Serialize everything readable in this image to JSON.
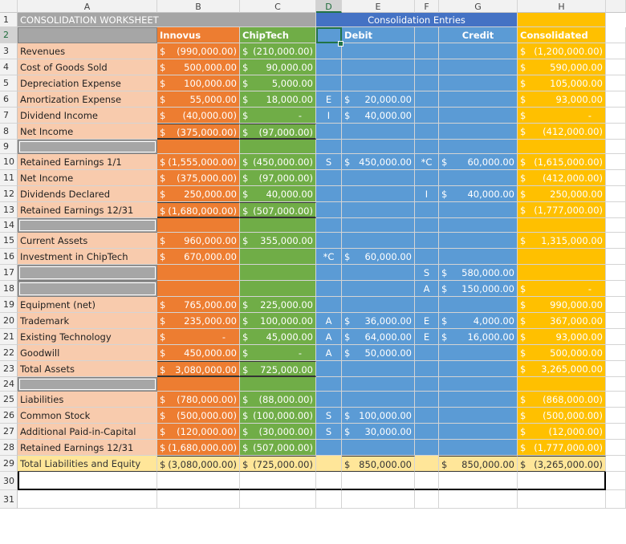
{
  "columns": [
    "A",
    "B",
    "C",
    "D",
    "E",
    "F",
    "G",
    "H"
  ],
  "rows": [
    {
      "n": "1",
      "a": "CONSOLIDATION WORKSHEET",
      "b": "",
      "c": "",
      "d": "",
      "e": "Consolidation Entries",
      "f": "",
      "g": "",
      "h": ""
    },
    {
      "n": "2",
      "a": "",
      "b": "Innovus",
      "c": "ChipTech",
      "d": "",
      "e": "Debit",
      "f": "",
      "g": "Credit",
      "h": "Consolidated"
    },
    {
      "n": "3",
      "a": "Revenues",
      "b": "(990,000.00)",
      "c": "(210,000.00)",
      "d": "",
      "e": "",
      "f": "",
      "g": "",
      "h": "(1,200,000.00)"
    },
    {
      "n": "4",
      "a": "Cost of Goods Sold",
      "b": "500,000.00",
      "c": "90,000.00",
      "d": "",
      "e": "",
      "f": "",
      "g": "",
      "h": "590,000.00"
    },
    {
      "n": "5",
      "a": "Depreciation Expense",
      "b": "100,000.00",
      "c": "5,000.00",
      "d": "",
      "e": "",
      "f": "",
      "g": "",
      "h": "105,000.00"
    },
    {
      "n": "6",
      "a": "Amortization Expense",
      "b": "55,000.00",
      "c": "18,000.00",
      "d": "E",
      "e": "20,000.00",
      "f": "",
      "g": "",
      "h": "93,000.00"
    },
    {
      "n": "7",
      "a": "Dividend Income",
      "b": "(40,000.00)",
      "c": "-",
      "d": "I",
      "e": "40,000.00",
      "f": "",
      "g": "",
      "h": "-"
    },
    {
      "n": "8",
      "a": "Net Income",
      "b": "(375,000.00)",
      "c": "(97,000.00)",
      "d": "",
      "e": "",
      "f": "",
      "g": "",
      "h": "(412,000.00)"
    },
    {
      "n": "9",
      "a": "",
      "b": "",
      "c": "",
      "d": "",
      "e": "",
      "f": "",
      "g": "",
      "h": ""
    },
    {
      "n": "10",
      "a": "Retained Earnings 1/1",
      "b": "(1,555,000.00)",
      "c": "(450,000.00)",
      "d": "S",
      "e": "450,000.00",
      "f": "*C",
      "g": "60,000.00",
      "h": "(1,615,000.00)"
    },
    {
      "n": "11",
      "a": "Net Income",
      "b": "(375,000.00)",
      "c": "(97,000.00)",
      "d": "",
      "e": "",
      "f": "",
      "g": "",
      "h": "(412,000.00)"
    },
    {
      "n": "12",
      "a": "Dividends Declared",
      "b": "250,000.00",
      "c": "40,000.00",
      "d": "",
      "e": "",
      "f": "I",
      "g": "40,000.00",
      "h": "250,000.00"
    },
    {
      "n": "13",
      "a": "Retained Earnings 12/31",
      "b": "(1,680,000.00)",
      "c": "(507,000.00)",
      "d": "",
      "e": "",
      "f": "",
      "g": "",
      "h": "(1,777,000.00)"
    },
    {
      "n": "14",
      "a": "",
      "b": "",
      "c": "",
      "d": "",
      "e": "",
      "f": "",
      "g": "",
      "h": ""
    },
    {
      "n": "15",
      "a": "Current Assets",
      "b": "960,000.00",
      "c": "355,000.00",
      "d": "",
      "e": "",
      "f": "",
      "g": "",
      "h": "1,315,000.00"
    },
    {
      "n": "16",
      "a": "Investment in ChipTech",
      "b": "670,000.00",
      "c": "",
      "d": "*C",
      "e": "60,000.00",
      "f": "",
      "g": "",
      "h": ""
    },
    {
      "n": "17",
      "a": "",
      "b": "",
      "c": "",
      "d": "",
      "e": "",
      "f": "S",
      "g": "580,000.00",
      "h": ""
    },
    {
      "n": "18",
      "a": "",
      "b": "",
      "c": "",
      "d": "",
      "e": "",
      "f": "A",
      "g": "150,000.00",
      "h": "-"
    },
    {
      "n": "19",
      "a": "Equipment (net)",
      "b": "765,000.00",
      "c": "225,000.00",
      "d": "",
      "e": "",
      "f": "",
      "g": "",
      "h": "990,000.00"
    },
    {
      "n": "20",
      "a": "Trademark",
      "b": "235,000.00",
      "c": "100,000.00",
      "d": "A",
      "e": "36,000.00",
      "f": "E",
      "g": "4,000.00",
      "h": "367,000.00"
    },
    {
      "n": "21",
      "a": "Existing Technology",
      "b": "-",
      "c": "45,000.00",
      "d": "A",
      "e": "64,000.00",
      "f": "E",
      "g": "16,000.00",
      "h": "93,000.00"
    },
    {
      "n": "22",
      "a": "Goodwill",
      "b": "450,000.00",
      "c": "-",
      "d": "A",
      "e": "50,000.00",
      "f": "",
      "g": "",
      "h": "500,000.00"
    },
    {
      "n": "23",
      "a": "Total Assets",
      "b": "3,080,000.00",
      "c": "725,000.00",
      "d": "",
      "e": "",
      "f": "",
      "g": "",
      "h": "3,265,000.00"
    },
    {
      "n": "24",
      "a": "",
      "b": "",
      "c": "",
      "d": "",
      "e": "",
      "f": "",
      "g": "",
      "h": ""
    },
    {
      "n": "25",
      "a": "Liabilities",
      "b": "(780,000.00)",
      "c": "(88,000.00)",
      "d": "",
      "e": "",
      "f": "",
      "g": "",
      "h": "(868,000.00)"
    },
    {
      "n": "26",
      "a": "Common Stock",
      "b": "(500,000.00)",
      "c": "(100,000.00)",
      "d": "S",
      "e": "100,000.00",
      "f": "",
      "g": "",
      "h": "(500,000.00)"
    },
    {
      "n": "27",
      "a": "Additional Paid-in-Capital",
      "b": "(120,000.00)",
      "c": "(30,000.00)",
      "d": "S",
      "e": "30,000.00",
      "f": "",
      "g": "",
      "h": "(12,000.00)"
    },
    {
      "n": "28",
      "a": "Retained Earnings 12/31",
      "b": "(1,680,000.00)",
      "c": "(507,000.00)",
      "d": "",
      "e": "",
      "f": "",
      "g": "",
      "h": "(1,777,000.00)"
    },
    {
      "n": "29",
      "a": "Total Liabilities and Equity",
      "b": "(3,080,000.00)",
      "c": "(725,000.00)",
      "d": "",
      "e": "850,000.00",
      "f": "",
      "g": "850,000.00",
      "h": "(3,265,000.00)"
    },
    {
      "n": "30",
      "a": "",
      "b": "",
      "c": "",
      "d": "",
      "e": "",
      "f": "",
      "g": "",
      "h": ""
    },
    {
      "n": "31",
      "a": "",
      "b": "",
      "c": "",
      "d": "",
      "e": "",
      "f": "",
      "g": "",
      "h": ""
    }
  ],
  "colors": {
    "col_a_fill": "#f8cbad",
    "col_b_fill": "#ed7d31",
    "col_c_fill": "#70ad47",
    "entries_fill": "#5b9bd5",
    "entries_header": "#4472c4",
    "consolidated_fill": "#ffc000",
    "title_fill": "#a5a5a5",
    "blank_label_fill": "#a6a6a6",
    "total_row_fill": "#ffe699"
  }
}
